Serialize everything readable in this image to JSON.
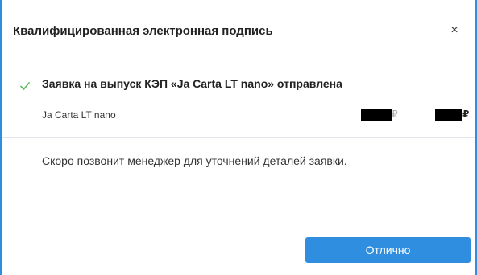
{
  "modal": {
    "title": "Квалифицированная электронная подпись",
    "close_label": "×"
  },
  "status": {
    "icon": "check-icon",
    "title": "Заявка на выпуск КЭП «Ja Carta LT nano» отправлена",
    "product_name": "Ja Carta LT nano",
    "price_old_currency": "₽",
    "price_new_currency": "₽"
  },
  "message": "Скоро позвонит менеджер для уточнений деталей заявки.",
  "actions": {
    "ok_label": "Отлично"
  },
  "colors": {
    "accent": "#2f8ee0",
    "check": "#5cb85c"
  }
}
